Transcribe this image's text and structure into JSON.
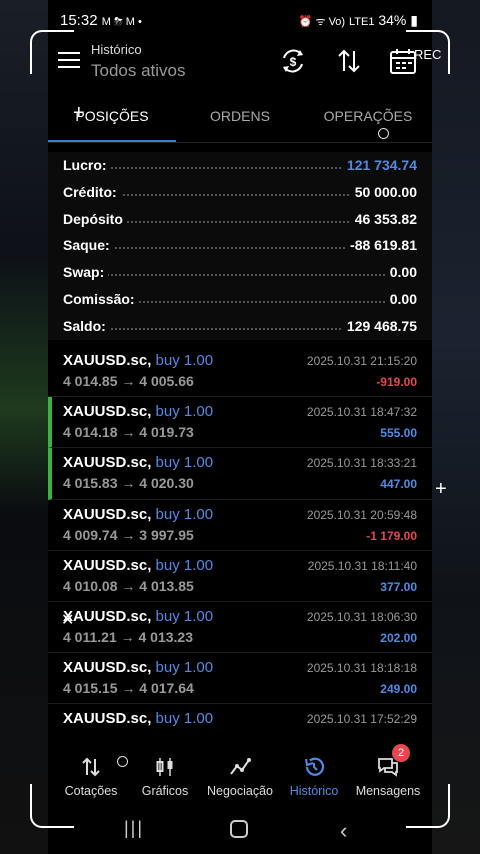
{
  "status": {
    "time": "15:32",
    "notif_icons": "M ⛈ M •",
    "right_icons": "⏰ ᯤ Vo)",
    "lte": "LTE1",
    "battery": "34%"
  },
  "header": {
    "title": "Histórico",
    "subtitle": "Todos ativos",
    "rec_label": "REC"
  },
  "tabs": [
    {
      "label": "POSIÇÕES",
      "active": true
    },
    {
      "label": "ORDENS",
      "active": false
    },
    {
      "label": "OPERAÇÕES",
      "active": false
    }
  ],
  "summary": [
    {
      "label": "Lucro:",
      "value": "121 734.74",
      "highlight": true
    },
    {
      "label": "Crédito:",
      "value": "50 000.00",
      "highlight": false
    },
    {
      "label": "Depósito",
      "value": "46 353.82",
      "highlight": false
    },
    {
      "label": "Saque:",
      "value": "-88 619.81",
      "highlight": false
    },
    {
      "label": "Swap:",
      "value": "0.00",
      "highlight": false
    },
    {
      "label": "Comissão:",
      "value": "0.00",
      "highlight": false
    },
    {
      "label": "Saldo:",
      "value": "129 468.75",
      "highlight": false
    }
  ],
  "deals": [
    {
      "symbol": "XAUUSD.sc,",
      "side": "buy 1.00",
      "prices": "4 014.85 → 4 005.66",
      "time": "2025.10.31 21:15:20",
      "profit": "-919.00",
      "positive": false,
      "marked": false
    },
    {
      "symbol": "XAUUSD.sc,",
      "side": "buy 1.00",
      "prices": "4 014.18 → 4 019.73",
      "time": "2025.10.31 18:47:32",
      "profit": "555.00",
      "positive": true,
      "marked": true
    },
    {
      "symbol": "XAUUSD.sc,",
      "side": "buy 1.00",
      "prices": "4 015.83 → 4 020.30",
      "time": "2025.10.31 18:33:21",
      "profit": "447.00",
      "positive": true,
      "marked": true
    },
    {
      "symbol": "XAUUSD.sc,",
      "side": "buy 1.00",
      "prices": "4 009.74 → 3 997.95",
      "time": "2025.10.31 20:59:48",
      "profit": "-1 179.00",
      "positive": false,
      "marked": false
    },
    {
      "symbol": "XAUUSD.sc,",
      "side": "buy 1.00",
      "prices": "4 010.08 → 4 013.85",
      "time": "2025.10.31 18:11:40",
      "profit": "377.00",
      "positive": true,
      "marked": false
    },
    {
      "symbol": "XAUUSD.sc,",
      "side": "buy 1.00",
      "prices": "4 011.21 → 4 013.23",
      "time": "2025.10.31 18:06:30",
      "profit": "202.00",
      "positive": true,
      "marked": false
    },
    {
      "symbol": "XAUUSD.sc,",
      "side": "buy 1.00",
      "prices": "4 015.15 → 4 017.64",
      "time": "2025.10.31 18:18:18",
      "profit": "249.00",
      "positive": true,
      "marked": false
    },
    {
      "symbol": "XAUUSD.sc,",
      "side": "buy 1.00",
      "prices": "",
      "time": "2025.10.31 17:52:29",
      "profit": "",
      "positive": true,
      "marked": false
    }
  ],
  "bottom_nav": [
    {
      "label": "Cotações",
      "icon": "arrows-updown-icon",
      "active": false
    },
    {
      "label": "Gráficos",
      "icon": "candlestick-icon",
      "active": false
    },
    {
      "label": "Negociação",
      "icon": "trend-line-icon",
      "active": false
    },
    {
      "label": "Histórico",
      "icon": "history-icon",
      "active": true
    },
    {
      "label": "Mensagens",
      "icon": "chat-icon",
      "active": false,
      "badge": "2"
    }
  ],
  "colors": {
    "accent": "#4f8be6",
    "negative": "#e5484d",
    "marker": "#3cb043"
  }
}
